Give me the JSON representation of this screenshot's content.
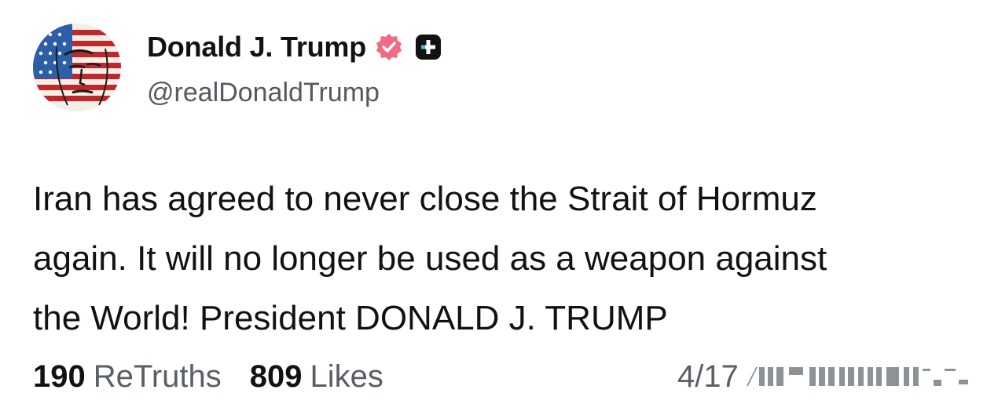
{
  "author": {
    "display_name": "Donald J. Trump",
    "handle": "@realDonaldTrump",
    "verified_icon": "verified-badge-icon",
    "verified_color": "#f06b83",
    "extra_icon": "plus-square-icon"
  },
  "post": {
    "text": "Iran has agreed to never close the Strait of Hormuz\nagain. It will no longer be used as a weapon against\nthe World! President DONALD J. TRUMP"
  },
  "stats": {
    "retruths_count": "190",
    "retruths_label": "ReTruths",
    "likes_count": "809",
    "likes_label": "Likes"
  },
  "timestamp": {
    "visible": "4/17"
  }
}
